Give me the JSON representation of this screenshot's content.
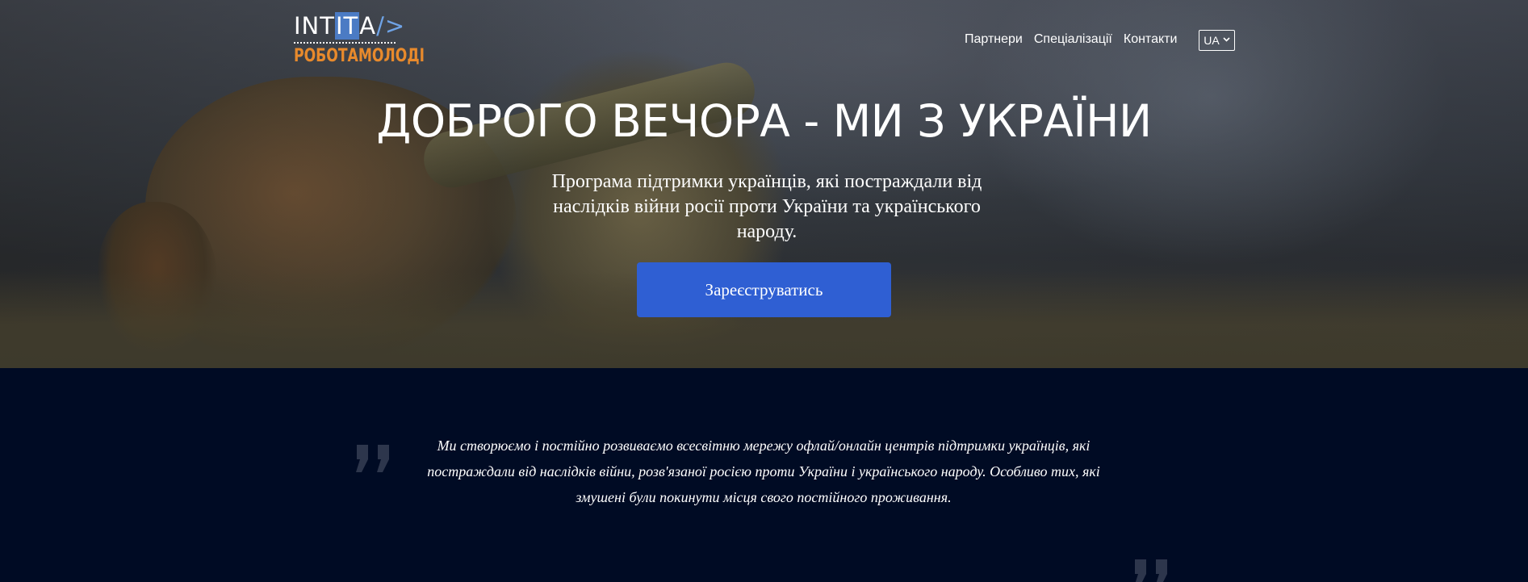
{
  "header": {
    "logo": {
      "top_text": "INTITA/>",
      "bottom_text": "РОБОТАМОЛОДІ"
    },
    "nav": [
      "Партнери",
      "Спеціалізації",
      "Контакти"
    ],
    "language": {
      "selected": "UA"
    }
  },
  "hero": {
    "title": "ДОБРОГО ВЕЧОРА - МИ З УКРАЇНИ",
    "subtitle": "Програма підтримки українців, які постраждали від наслідків війни росії проти України та українського народу.",
    "cta_label": "Зареєструватись"
  },
  "quote": {
    "text": "Ми створюємо і постійно розвиваємо всесвітню мережу офлай/онлайн центрів підтримки українців, які постраждали від наслідків війни, розв'язаної росією проти України і українського народу. Особливо тих, які змушені були покинути місця свого постійного проживання."
  },
  "icons": {
    "open_quote": "quote-open-icon",
    "close_quote": "quote-close-icon",
    "language_chevron": "chevron-down-icon"
  },
  "colors": {
    "cta": "#2f5fd3",
    "section_bg": "#000b24",
    "logo_accent": "#e88a2c",
    "logo_highlight": "#4b7bc4"
  }
}
